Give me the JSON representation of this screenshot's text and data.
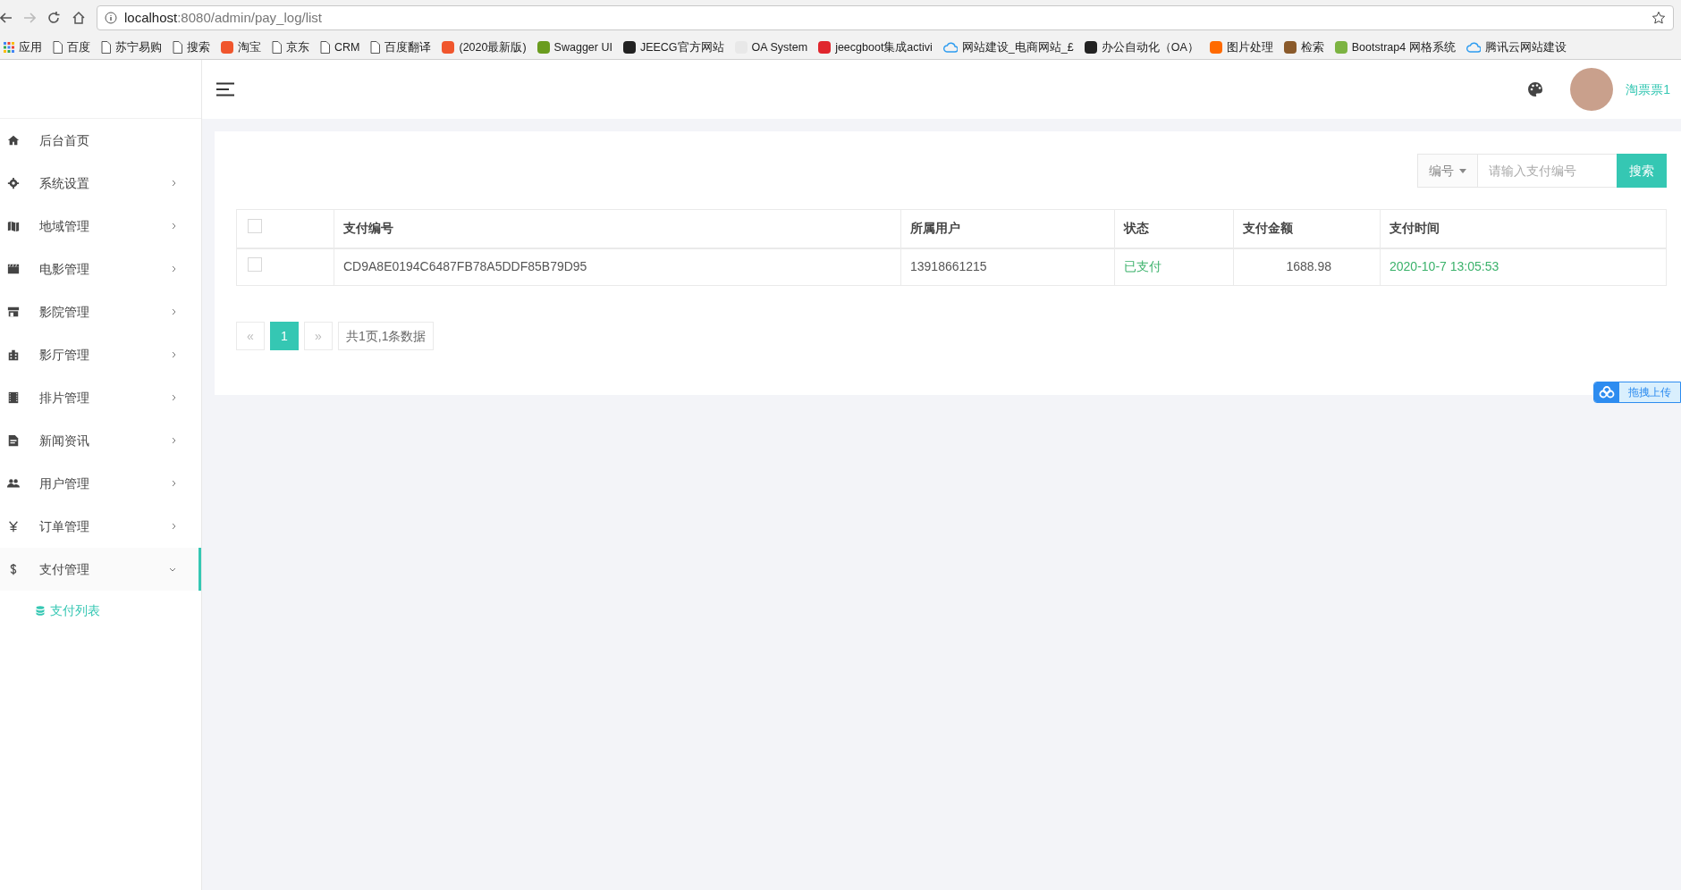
{
  "browser": {
    "address_host": "localhost",
    "address_path": ":8080/admin/pay_log/list",
    "bookmarks": [
      {
        "label": "应用",
        "kind": "apps"
      },
      {
        "label": "百度",
        "kind": "page"
      },
      {
        "label": "苏宁易购",
        "kind": "page"
      },
      {
        "label": "搜索",
        "kind": "page"
      },
      {
        "label": "淘宝",
        "kind": "site",
        "color": "#f0562d"
      },
      {
        "label": "京东",
        "kind": "page"
      },
      {
        "label": "CRM",
        "kind": "page"
      },
      {
        "label": "百度翻译",
        "kind": "page"
      },
      {
        "label": "(2020最新版)",
        "kind": "site",
        "color": "#f0562d"
      },
      {
        "label": "Swagger UI",
        "kind": "site",
        "color": "#6a9c1f"
      },
      {
        "label": "JEECG官方网站",
        "kind": "site",
        "color": "#222222"
      },
      {
        "label": "OA System",
        "kind": "site",
        "color": "#e8e8e8"
      },
      {
        "label": "jeecgboot集成activi",
        "kind": "site",
        "color": "#e0262d"
      },
      {
        "label": "网站建设_电商网站_£",
        "kind": "cloud"
      },
      {
        "label": "办公自动化（OA）",
        "kind": "site",
        "color": "#222222"
      },
      {
        "label": "图片处理",
        "kind": "site",
        "color": "#ff6a00"
      },
      {
        "label": "检索",
        "kind": "site",
        "color": "#8a5a2b"
      },
      {
        "label": "Bootstrap4 网格系统",
        "kind": "site",
        "color": "#7cb342"
      },
      {
        "label": "腾讯云网站建设",
        "kind": "cloud"
      }
    ]
  },
  "sidebar": {
    "items": [
      {
        "label": "后台首页",
        "expandable": false,
        "selected": false
      },
      {
        "label": "系统设置",
        "expandable": true,
        "expanded": false,
        "selected": false
      },
      {
        "label": "地域管理",
        "expandable": true,
        "expanded": false,
        "selected": false
      },
      {
        "label": "电影管理",
        "expandable": true,
        "expanded": false,
        "selected": false
      },
      {
        "label": "影院管理",
        "expandable": true,
        "expanded": false,
        "selected": false
      },
      {
        "label": "影厅管理",
        "expandable": true,
        "expanded": false,
        "selected": false
      },
      {
        "label": "排片管理",
        "expandable": true,
        "expanded": false,
        "selected": false
      },
      {
        "label": "新闻资讯",
        "expandable": true,
        "expanded": false,
        "selected": false
      },
      {
        "label": "用户管理",
        "expandable": true,
        "expanded": false,
        "selected": false
      },
      {
        "label": "订单管理",
        "expandable": true,
        "expanded": false,
        "selected": false
      },
      {
        "label": "支付管理",
        "expandable": true,
        "expanded": true,
        "selected": true,
        "children": [
          {
            "label": "支付列表",
            "selected": true
          }
        ]
      }
    ]
  },
  "header": {
    "user_name": "淘票票1"
  },
  "search": {
    "field_select": "编号",
    "placeholder": "请输入支付编号",
    "button": "搜索"
  },
  "table": {
    "header_checked": false,
    "columns": [
      "支付编号",
      "所属用户",
      "状态",
      "支付金额",
      "支付时间"
    ],
    "rows": [
      {
        "checked": false,
        "cells": [
          "CD9A8E0194C6487FB78A5DDF85B79D95",
          "13918661215",
          "已支付",
          "1688.98",
          "2020-10-7 13:05:53"
        ]
      }
    ]
  },
  "pagination": {
    "prev": "«",
    "pages": [
      {
        "label": "1",
        "selected": true
      }
    ],
    "next": "»",
    "summary": "共1页,1条数据"
  },
  "upload_widget": {
    "label": "拖拽上传"
  }
}
